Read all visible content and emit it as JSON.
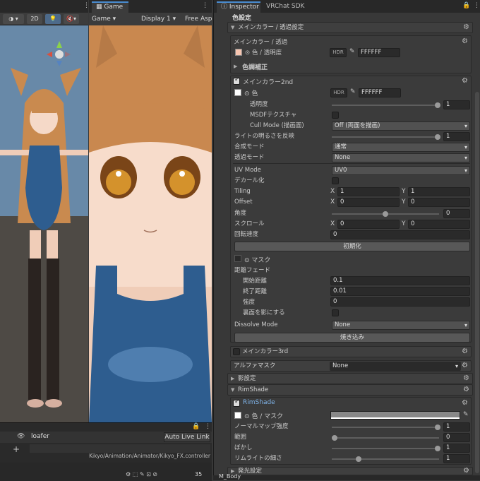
{
  "scene": {
    "btn_2d": "2D"
  },
  "game": {
    "tab_label": "Game",
    "mode_dropdown": "Game",
    "display_dropdown": "Display 1",
    "aspect_dropdown": "Free Asp"
  },
  "animator": {
    "layer_name": "loafer",
    "auto_live_link": "Auto Live Link",
    "controller_path": "Kikyo/Animation/Animator/Kikyo_FX.controller",
    "status_count": "35"
  },
  "inspector": {
    "tab_inspector": "Inspector",
    "tab_vrchat": "VRChat SDK",
    "header_title": "色設定",
    "sections": {
      "main_color": "メインカラー / 透過設定",
      "main_color_sub": "メインカラー / 透過",
      "color_alpha_label": "色 / 透明度",
      "hex1": "FFFFFF",
      "color_correction": "色調補正",
      "main2nd": "メインカラー2nd",
      "color_label": "色",
      "hex2": "FFFFFF",
      "main3rd": "メインカラー3rd",
      "alpha_mask": "アルファマスク",
      "alpha_mask_value": "None",
      "shadow": "影設定",
      "rimshade": "RimShade",
      "rimshade_sub": "RimShade",
      "rim_color_mask": "色 / マスク",
      "emission": "発光設定"
    },
    "hdr_label": "HDR",
    "props": {
      "transparency": {
        "label": "透明度",
        "value": "1"
      },
      "msdf": {
        "label": "MSDFテクスチャ"
      },
      "cull": {
        "label": "Cull Mode (描画面)",
        "value": "Off (両面を描画)"
      },
      "light": {
        "label": "ライトの明るさを反映",
        "value": "1"
      },
      "blend": {
        "label": "合成モード",
        "value": "通常"
      },
      "transmode": {
        "label": "透過モード",
        "value": "None"
      },
      "uv": {
        "label": "UV Mode",
        "value": "UV0"
      },
      "decal": {
        "label": "デカール化"
      },
      "tiling": {
        "label": "Tiling",
        "x": "1",
        "y": "1"
      },
      "offset": {
        "label": "Offset",
        "x": "0",
        "y": "0"
      },
      "angle": {
        "label": "角度",
        "value": "0"
      },
      "scroll": {
        "label": "スクロール",
        "x": "0",
        "y": "0"
      },
      "rotspeed": {
        "label": "回転速度",
        "value": "0"
      },
      "reset": "初期化",
      "mask": "マスク",
      "distfade": "距離フェード",
      "startdist": {
        "label": "開始距離",
        "value": "0.1"
      },
      "enddist": {
        "label": "終了距離",
        "value": "0.01"
      },
      "strength": {
        "label": "強度",
        "value": "0"
      },
      "backface": {
        "label": "裏面を影にする"
      },
      "dissolve": {
        "label": "Dissolve Mode",
        "value": "None"
      },
      "bake": "焼き込み",
      "normal_strength": {
        "label": "ノーマルマップ強度",
        "value": "1"
      },
      "range": {
        "label": "範囲",
        "value": "0"
      },
      "blur": {
        "label": "ぼかし",
        "value": "1"
      },
      "rimlight": {
        "label": "リムライトの細さ",
        "value": "1"
      }
    },
    "xlabel": "X",
    "ylabel": "Y",
    "bottom_label": "M_Body"
  }
}
